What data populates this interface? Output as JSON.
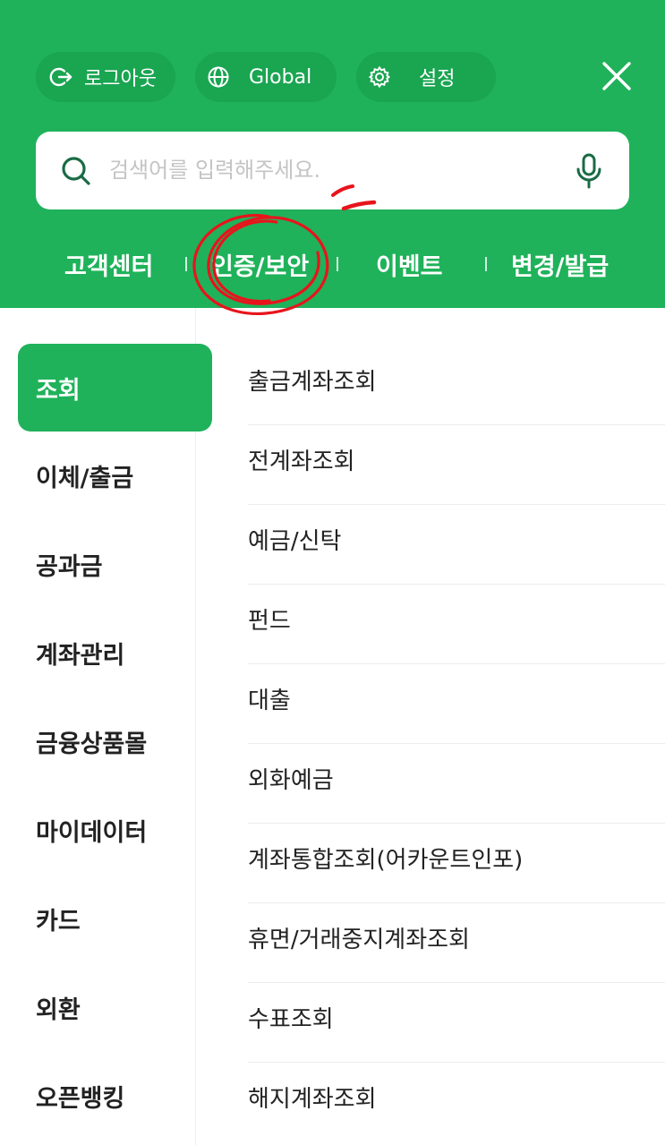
{
  "top_pills": {
    "logout_label": "로그아웃",
    "global_label": "Global",
    "settings_label": "설정"
  },
  "search": {
    "placeholder": "검색어를 입력해주세요."
  },
  "quick_links": [
    "고객센터",
    "인증/보안",
    "이벤트",
    "변경/발급"
  ],
  "categories": [
    "조회",
    "이체/출금",
    "공과금",
    "계좌관리",
    "금융상품몰",
    "마이데이터",
    "카드",
    "외환",
    "오픈뱅킹"
  ],
  "active_category": "조회",
  "sub_items": [
    "출금계좌조회",
    "전계좌조회",
    "예금/신탁",
    "펀드",
    "대출",
    "외화예금",
    "계좌통합조회(어카운트인포)",
    "휴면/거래중지계좌조회",
    "수표조회",
    "해지계좌조회"
  ],
  "colors": {
    "brand_green": "#1fb25a",
    "pill_green": "#1aa551",
    "annotation_red": "#e8141c",
    "search_icon": "#1a6b45"
  },
  "icons": {
    "logout": "logout-icon",
    "global": "globe-icon",
    "settings": "gear-icon",
    "close": "close-icon",
    "search": "search-icon",
    "mic": "mic-icon"
  }
}
